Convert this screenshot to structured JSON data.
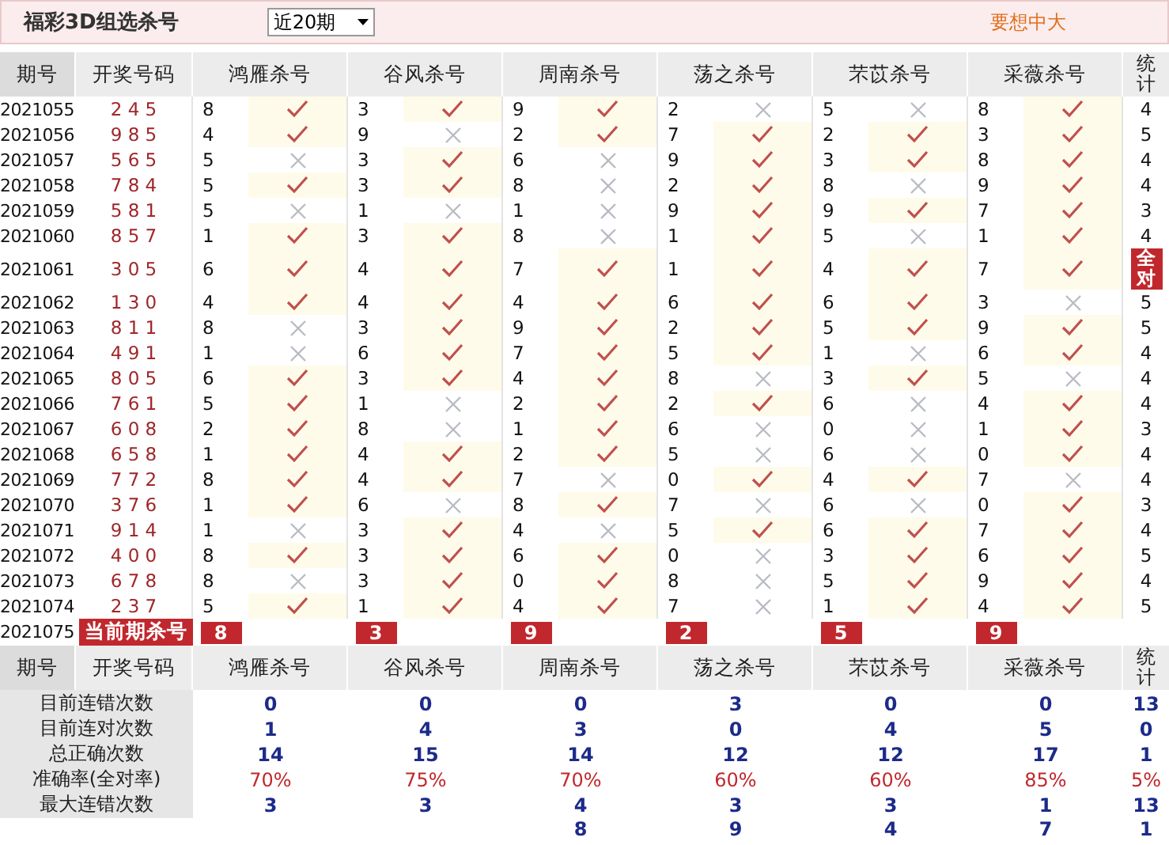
{
  "topbar": {
    "title": "福彩3D组选杀号",
    "range_select": "近20期",
    "promo": "要想中大"
  },
  "columns": [
    "期号",
    "开奖号码",
    "鸿雁杀号",
    "谷风杀号",
    "周南杀号",
    "荡之杀号",
    "芣苡杀号",
    "采薇杀号",
    "统计"
  ],
  "rows": [
    {
      "period": "2021055",
      "draw": "2 4 5",
      "kills": [
        {
          "num": "8",
          "hit": true
        },
        {
          "num": "3",
          "hit": true
        },
        {
          "num": "9",
          "hit": true
        },
        {
          "num": "2",
          "hit": false
        },
        {
          "num": "5",
          "hit": false
        },
        {
          "num": "8",
          "hit": true
        }
      ],
      "stat": "4",
      "full_hit": false
    },
    {
      "period": "2021056",
      "draw": "9 8 5",
      "kills": [
        {
          "num": "4",
          "hit": true
        },
        {
          "num": "9",
          "hit": false
        },
        {
          "num": "2",
          "hit": true
        },
        {
          "num": "7",
          "hit": true
        },
        {
          "num": "2",
          "hit": true
        },
        {
          "num": "3",
          "hit": true
        }
      ],
      "stat": "5",
      "full_hit": false
    },
    {
      "period": "2021057",
      "draw": "5 6 5",
      "kills": [
        {
          "num": "5",
          "hit": false
        },
        {
          "num": "3",
          "hit": true
        },
        {
          "num": "6",
          "hit": false
        },
        {
          "num": "9",
          "hit": true
        },
        {
          "num": "3",
          "hit": true
        },
        {
          "num": "8",
          "hit": true
        }
      ],
      "stat": "4",
      "full_hit": false
    },
    {
      "period": "2021058",
      "draw": "7 8 4",
      "kills": [
        {
          "num": "5",
          "hit": true
        },
        {
          "num": "3",
          "hit": true
        },
        {
          "num": "8",
          "hit": false
        },
        {
          "num": "2",
          "hit": true
        },
        {
          "num": "8",
          "hit": false
        },
        {
          "num": "9",
          "hit": true
        }
      ],
      "stat": "4",
      "full_hit": false
    },
    {
      "period": "2021059",
      "draw": "5 8 1",
      "kills": [
        {
          "num": "5",
          "hit": false
        },
        {
          "num": "1",
          "hit": false
        },
        {
          "num": "1",
          "hit": false
        },
        {
          "num": "9",
          "hit": true
        },
        {
          "num": "9",
          "hit": true
        },
        {
          "num": "7",
          "hit": true
        }
      ],
      "stat": "3",
      "full_hit": false
    },
    {
      "period": "2021060",
      "draw": "8 5 7",
      "kills": [
        {
          "num": "1",
          "hit": true
        },
        {
          "num": "3",
          "hit": true
        },
        {
          "num": "8",
          "hit": false
        },
        {
          "num": "1",
          "hit": true
        },
        {
          "num": "5",
          "hit": false
        },
        {
          "num": "1",
          "hit": true
        }
      ],
      "stat": "4",
      "full_hit": false
    },
    {
      "period": "2021061",
      "draw": "3 0 5",
      "kills": [
        {
          "num": "6",
          "hit": true
        },
        {
          "num": "4",
          "hit": true
        },
        {
          "num": "7",
          "hit": true
        },
        {
          "num": "1",
          "hit": true
        },
        {
          "num": "4",
          "hit": true
        },
        {
          "num": "7",
          "hit": true
        }
      ],
      "stat": "全对",
      "full_hit": true
    },
    {
      "period": "2021062",
      "draw": "1 3 0",
      "kills": [
        {
          "num": "4",
          "hit": true
        },
        {
          "num": "4",
          "hit": true
        },
        {
          "num": "4",
          "hit": true
        },
        {
          "num": "6",
          "hit": true
        },
        {
          "num": "6",
          "hit": true
        },
        {
          "num": "3",
          "hit": false
        }
      ],
      "stat": "5",
      "full_hit": false
    },
    {
      "period": "2021063",
      "draw": "8 1 1",
      "kills": [
        {
          "num": "8",
          "hit": false
        },
        {
          "num": "3",
          "hit": true
        },
        {
          "num": "9",
          "hit": true
        },
        {
          "num": "2",
          "hit": true
        },
        {
          "num": "5",
          "hit": true
        },
        {
          "num": "9",
          "hit": true
        }
      ],
      "stat": "5",
      "full_hit": false
    },
    {
      "period": "2021064",
      "draw": "4 9 1",
      "kills": [
        {
          "num": "1",
          "hit": false
        },
        {
          "num": "6",
          "hit": true
        },
        {
          "num": "7",
          "hit": true
        },
        {
          "num": "5",
          "hit": true
        },
        {
          "num": "1",
          "hit": false
        },
        {
          "num": "6",
          "hit": true
        }
      ],
      "stat": "4",
      "full_hit": false
    },
    {
      "period": "2021065",
      "draw": "8 0 5",
      "kills": [
        {
          "num": "6",
          "hit": true
        },
        {
          "num": "3",
          "hit": true
        },
        {
          "num": "4",
          "hit": true
        },
        {
          "num": "8",
          "hit": false
        },
        {
          "num": "3",
          "hit": true
        },
        {
          "num": "5",
          "hit": false
        }
      ],
      "stat": "4",
      "full_hit": false
    },
    {
      "period": "2021066",
      "draw": "7 6 1",
      "kills": [
        {
          "num": "5",
          "hit": true
        },
        {
          "num": "1",
          "hit": false
        },
        {
          "num": "2",
          "hit": true
        },
        {
          "num": "2",
          "hit": true
        },
        {
          "num": "6",
          "hit": false
        },
        {
          "num": "4",
          "hit": true
        }
      ],
      "stat": "4",
      "full_hit": false
    },
    {
      "period": "2021067",
      "draw": "6 0 8",
      "kills": [
        {
          "num": "2",
          "hit": true
        },
        {
          "num": "8",
          "hit": false
        },
        {
          "num": "1",
          "hit": true
        },
        {
          "num": "6",
          "hit": false
        },
        {
          "num": "0",
          "hit": false
        },
        {
          "num": "1",
          "hit": true
        }
      ],
      "stat": "3",
      "full_hit": false
    },
    {
      "period": "2021068",
      "draw": "6 5 8",
      "kills": [
        {
          "num": "1",
          "hit": true
        },
        {
          "num": "4",
          "hit": true
        },
        {
          "num": "2",
          "hit": true
        },
        {
          "num": "5",
          "hit": false
        },
        {
          "num": "6",
          "hit": false
        },
        {
          "num": "0",
          "hit": true
        }
      ],
      "stat": "4",
      "full_hit": false
    },
    {
      "period": "2021069",
      "draw": "7 7 2",
      "kills": [
        {
          "num": "8",
          "hit": true
        },
        {
          "num": "4",
          "hit": true
        },
        {
          "num": "7",
          "hit": false
        },
        {
          "num": "0",
          "hit": true
        },
        {
          "num": "4",
          "hit": true
        },
        {
          "num": "7",
          "hit": false
        }
      ],
      "stat": "4",
      "full_hit": false
    },
    {
      "period": "2021070",
      "draw": "3 7 6",
      "kills": [
        {
          "num": "1",
          "hit": true
        },
        {
          "num": "6",
          "hit": false
        },
        {
          "num": "8",
          "hit": true
        },
        {
          "num": "7",
          "hit": false
        },
        {
          "num": "6",
          "hit": false
        },
        {
          "num": "0",
          "hit": true
        }
      ],
      "stat": "3",
      "full_hit": false
    },
    {
      "period": "2021071",
      "draw": "9 1 4",
      "kills": [
        {
          "num": "1",
          "hit": false
        },
        {
          "num": "3",
          "hit": true
        },
        {
          "num": "4",
          "hit": false
        },
        {
          "num": "5",
          "hit": true
        },
        {
          "num": "6",
          "hit": true
        },
        {
          "num": "7",
          "hit": true
        }
      ],
      "stat": "4",
      "full_hit": false
    },
    {
      "period": "2021072",
      "draw": "4 0 0",
      "kills": [
        {
          "num": "8",
          "hit": true
        },
        {
          "num": "3",
          "hit": true
        },
        {
          "num": "6",
          "hit": true
        },
        {
          "num": "0",
          "hit": false
        },
        {
          "num": "3",
          "hit": true
        },
        {
          "num": "6",
          "hit": true
        }
      ],
      "stat": "5",
      "full_hit": false
    },
    {
      "period": "2021073",
      "draw": "6 7 8",
      "kills": [
        {
          "num": "8",
          "hit": false
        },
        {
          "num": "3",
          "hit": true
        },
        {
          "num": "0",
          "hit": true
        },
        {
          "num": "8",
          "hit": false
        },
        {
          "num": "5",
          "hit": true
        },
        {
          "num": "9",
          "hit": true
        }
      ],
      "stat": "4",
      "full_hit": false
    },
    {
      "period": "2021074",
      "draw": "2 3 7",
      "kills": [
        {
          "num": "5",
          "hit": true
        },
        {
          "num": "1",
          "hit": true
        },
        {
          "num": "4",
          "hit": true
        },
        {
          "num": "7",
          "hit": false
        },
        {
          "num": "1",
          "hit": true
        },
        {
          "num": "4",
          "hit": true
        }
      ],
      "stat": "5",
      "full_hit": false
    }
  ],
  "current": {
    "period": "2021075",
    "label": "当前期杀号",
    "kills": [
      "8",
      "3",
      "9",
      "2",
      "5",
      "9"
    ]
  },
  "footer_columns": [
    "期号",
    "开奖号码",
    "鸿雁杀号",
    "谷风杀号",
    "周南杀号",
    "荡之杀号",
    "芣苡杀号",
    "采薇杀号",
    "统计"
  ],
  "stats": [
    {
      "label": "目前连错次数",
      "kind": "count",
      "values": [
        "0",
        "0",
        "0",
        "3",
        "0",
        "0",
        "13"
      ]
    },
    {
      "label": "目前连对次数",
      "kind": "count",
      "values": [
        "1",
        "4",
        "3",
        "0",
        "4",
        "5",
        "0"
      ]
    },
    {
      "label": "总正确次数",
      "kind": "count",
      "values": [
        "14",
        "15",
        "14",
        "12",
        "12",
        "17",
        "1"
      ]
    },
    {
      "label": "准确率(全对率)",
      "kind": "rate",
      "values": [
        "70%",
        "75%",
        "70%",
        "60%",
        "60%",
        "85%",
        "5%"
      ]
    },
    {
      "label": "最大连错次数",
      "kind": "count",
      "values": [
        "3",
        "3",
        "4",
        "3",
        "3",
        "1",
        "13"
      ]
    },
    {
      "kind": "count",
      "values": [
        "8",
        "9",
        "4",
        "7",
        "1"
      ]
    }
  ]
}
